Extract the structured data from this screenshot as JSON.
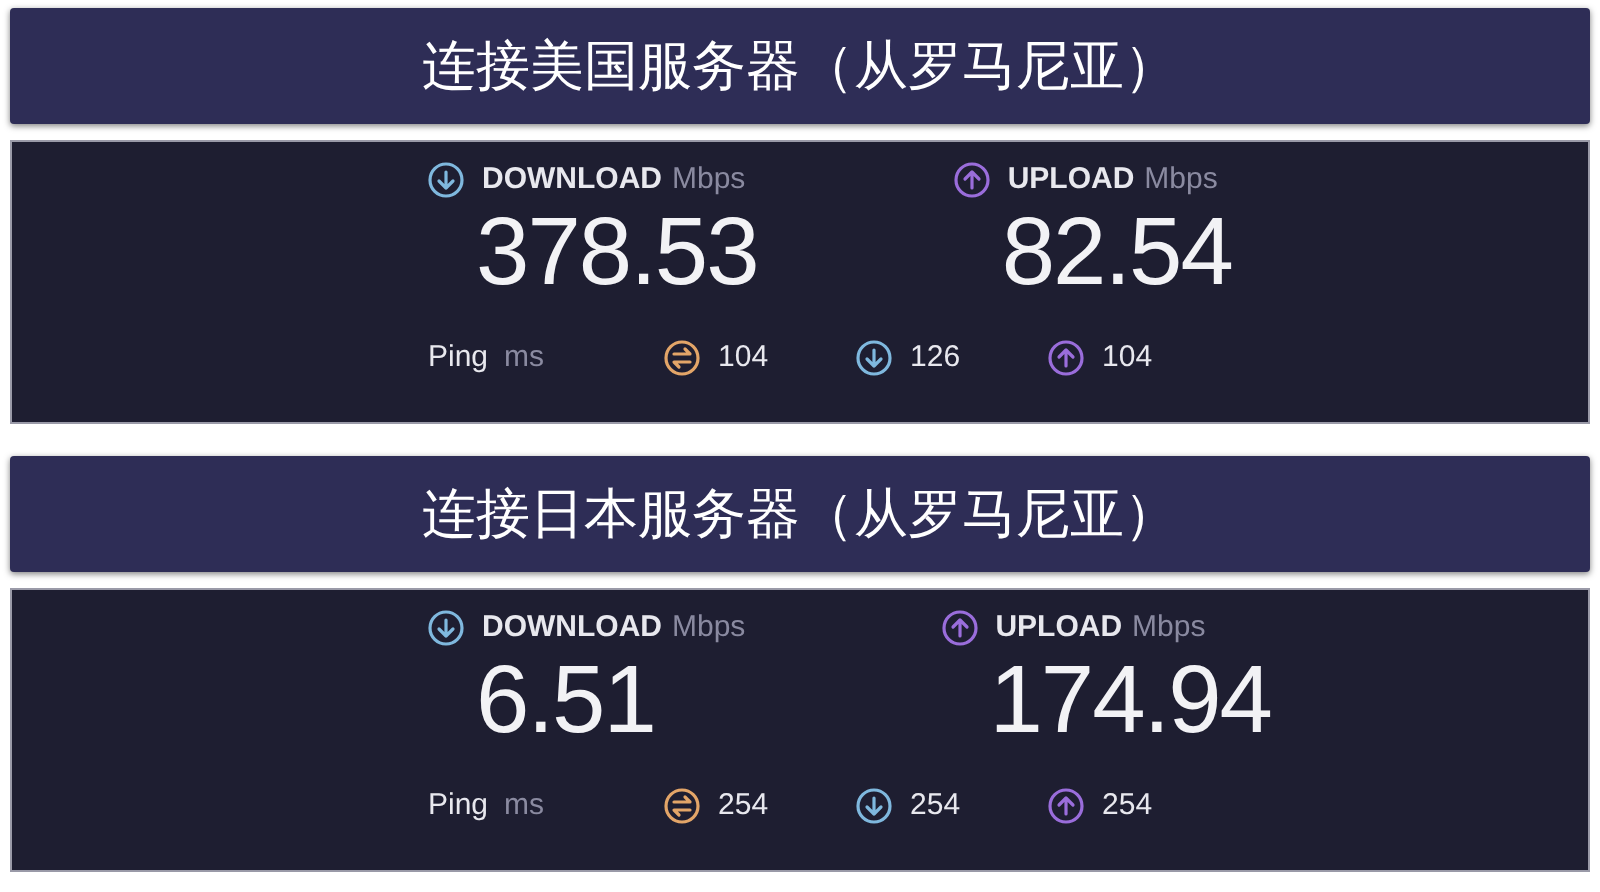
{
  "sections": [
    {
      "title": "连接美国服务器（从罗马尼亚）",
      "download": {
        "label": "DOWNLOAD",
        "unit": "Mbps",
        "value": "378.53"
      },
      "upload": {
        "label": "UPLOAD",
        "unit": "Mbps",
        "value": "82.54"
      },
      "ping": {
        "label": "Ping",
        "unit": "ms",
        "readings": [
          {
            "kind": "ping",
            "value": "104"
          },
          {
            "kind": "download",
            "value": "126"
          },
          {
            "kind": "upload",
            "value": "104"
          }
        ]
      }
    },
    {
      "title": "连接日本服务器（从罗马尼亚）",
      "download": {
        "label": "DOWNLOAD",
        "unit": "Mbps",
        "value": "6.51"
      },
      "upload": {
        "label": "UPLOAD",
        "unit": "Mbps",
        "value": "174.94"
      },
      "ping": {
        "label": "Ping",
        "unit": "ms",
        "readings": [
          {
            "kind": "ping",
            "value": "254"
          },
          {
            "kind": "download",
            "value": "254"
          },
          {
            "kind": "upload",
            "value": "254"
          }
        ]
      }
    }
  ]
}
